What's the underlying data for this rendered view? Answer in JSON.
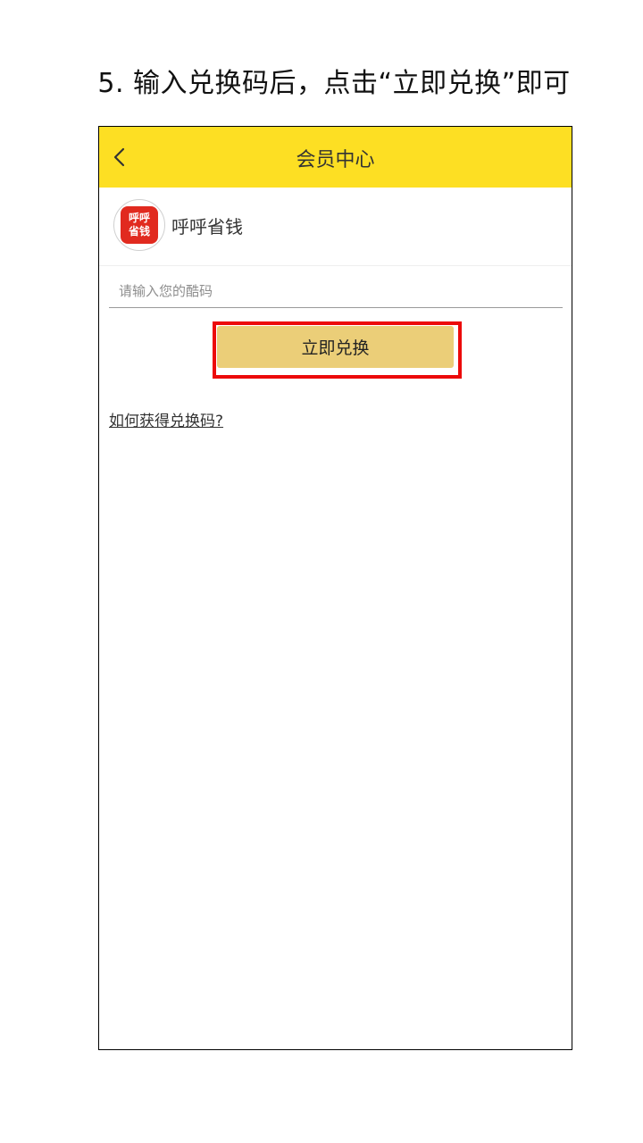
{
  "instruction": {
    "text": "5. 输入兑换码后，点击“立即兑换”即可"
  },
  "nav": {
    "title": "会员中心",
    "back_icon": "chevron-left-icon",
    "background_color": "#fddf23"
  },
  "app": {
    "logo_line1": "呼呼",
    "logo_line2": "省钱",
    "name": "呼呼省钱",
    "logo_color": "#e12a1f"
  },
  "redeem": {
    "input_placeholder": "请输入您的酷码",
    "input_value": "",
    "button_label": "立即兑换",
    "button_color": "#ebce78",
    "highlight_color": "#ec0a0a"
  },
  "help": {
    "link_text": "如何获得兑换码?"
  }
}
